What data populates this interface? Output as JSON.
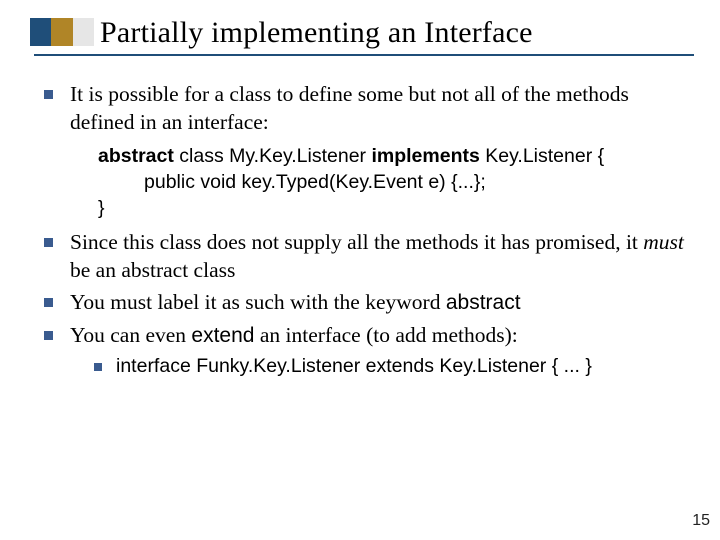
{
  "title": "Partially implementing an Interface",
  "bullets": {
    "b1": "It is possible for a class to define some but not all of the methods defined in an interface:",
    "code": {
      "kw_abstract": "abstract",
      "tx1": " class My.Key.Listener ",
      "kw_implements": "implements",
      "tx2": " Key.Listener {",
      "line2": "public void key.Typed(Key.Event e) {...};",
      "line3": "}"
    },
    "b2_a": "Since this class does not supply all the methods it has promised, it ",
    "b2_must": "must",
    "b2_b": " be an abstract class",
    "b3_a": "You must label it as such with the keyword ",
    "b3_kw": "abstract",
    "b4_a": "You can even ",
    "b4_kw": "extend",
    "b4_b": " an interface (to add methods):",
    "sub1": "interface Funky.Key.Listener extends Key.Listener { ... }"
  },
  "page_number": "15"
}
